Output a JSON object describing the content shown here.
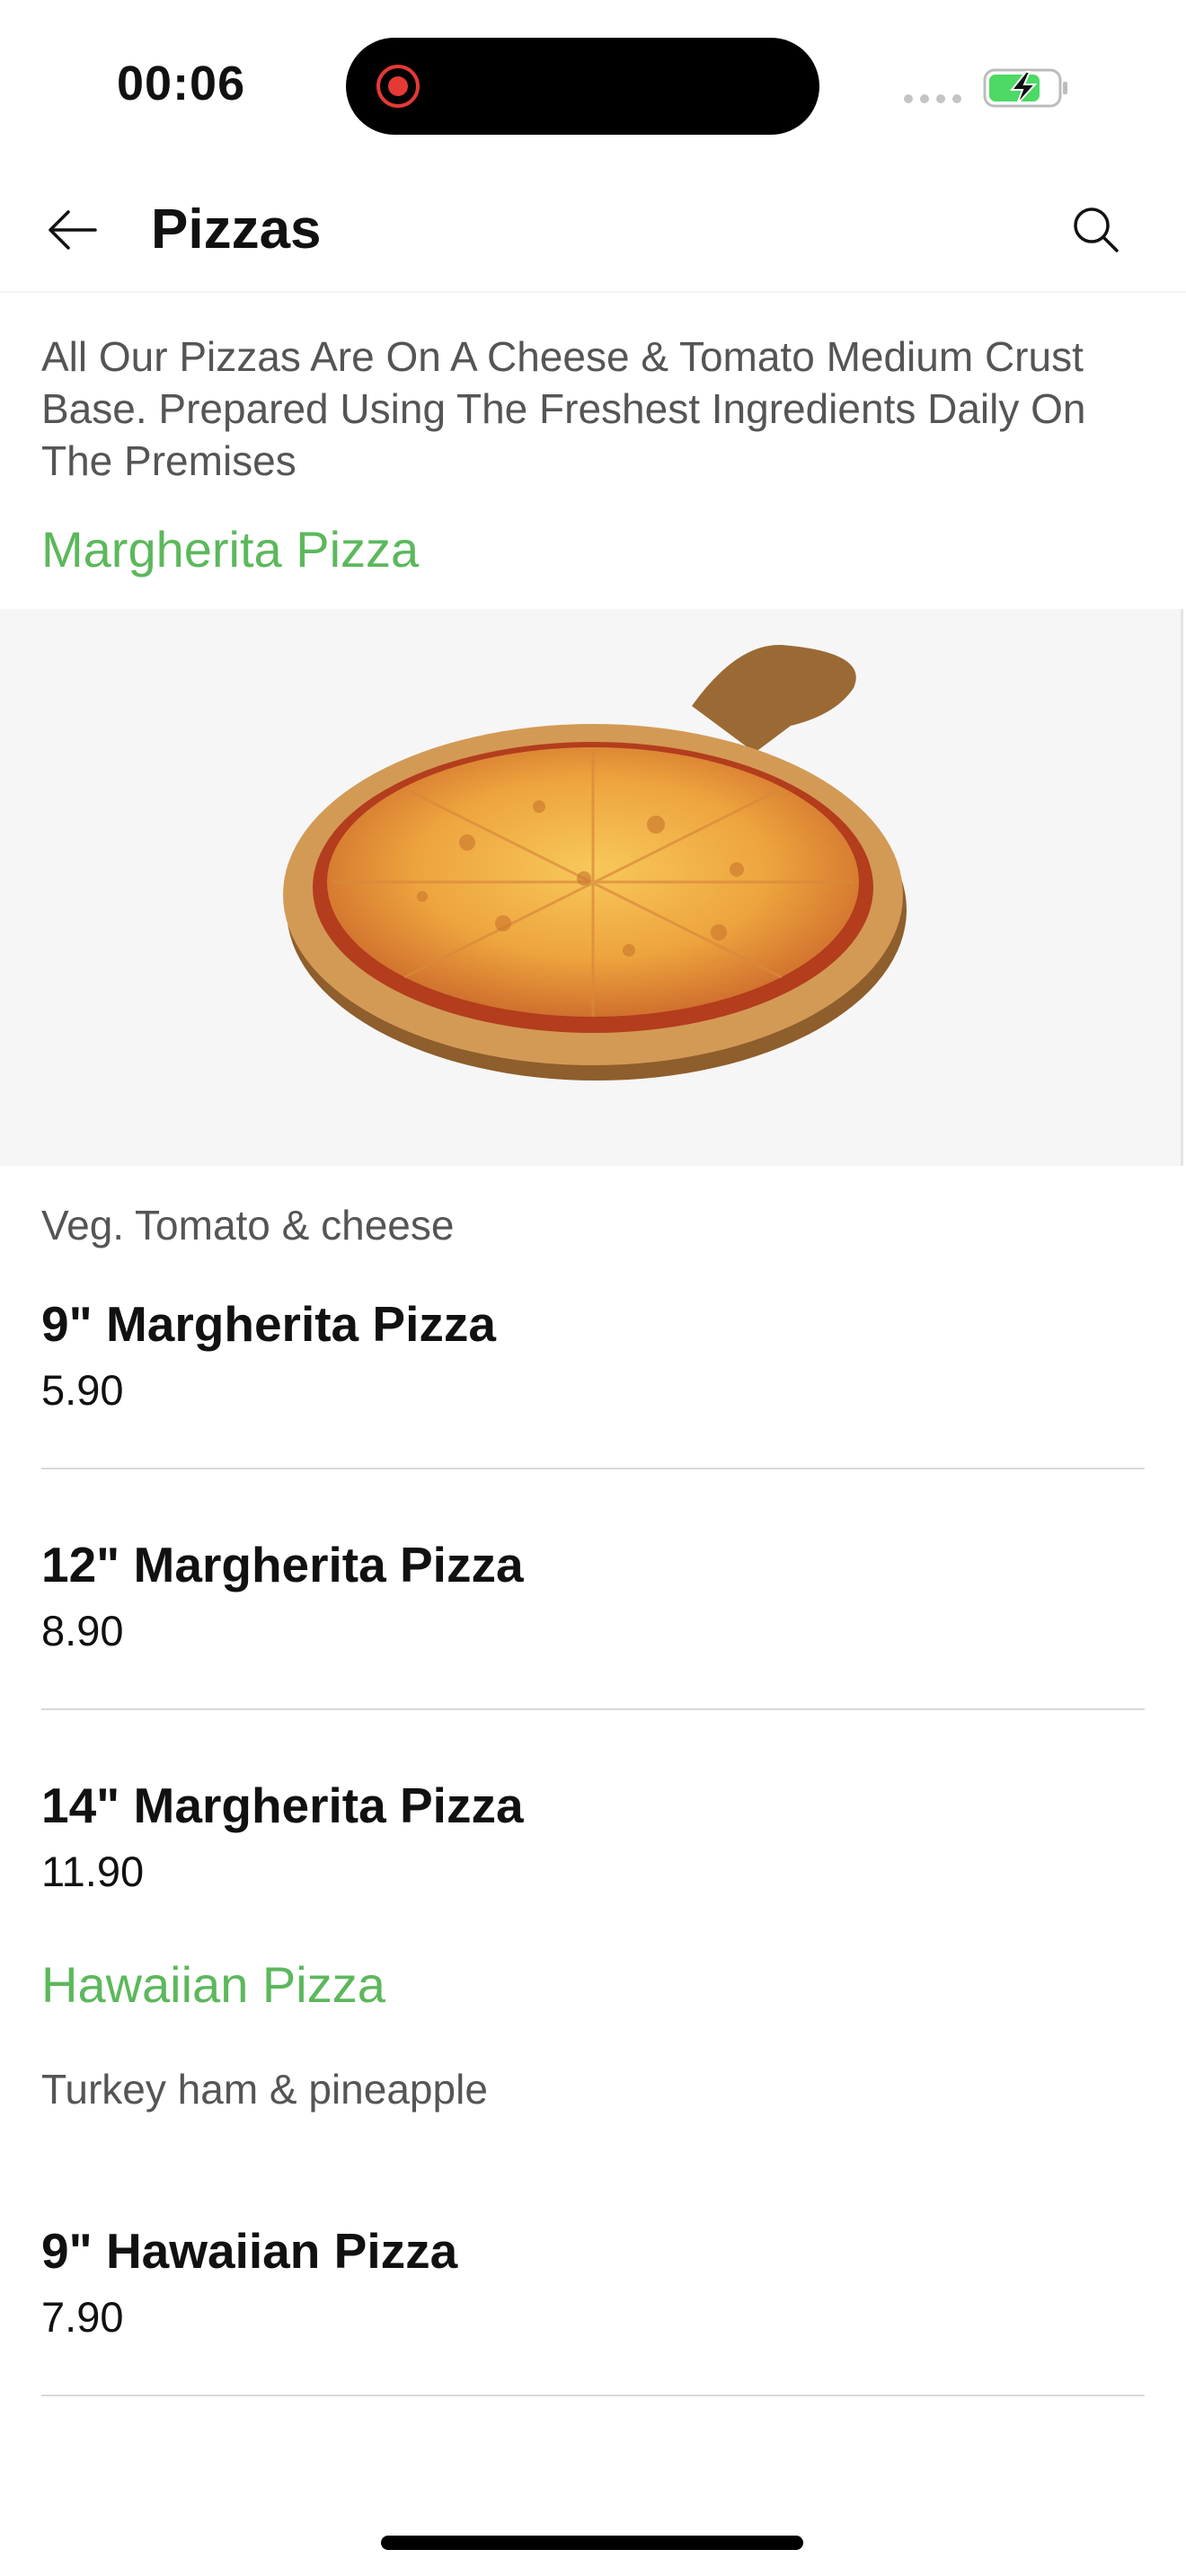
{
  "status_bar": {
    "time": "00:06"
  },
  "header": {
    "title": "Pizzas"
  },
  "intro": "All Our Pizzas Are On A Cheese & Tomato Medium Crust Base. Prepared Using The Freshest Ingredients Daily On The Premises",
  "sections": [
    {
      "title": "Margherita Pizza",
      "description": "Veg. Tomato & cheese",
      "items": [
        {
          "name": "9\" Margherita Pizza",
          "price": "5.90"
        },
        {
          "name": "12\" Margherita Pizza",
          "price": "8.90"
        },
        {
          "name": "14\" Margherita Pizza",
          "price": "11.90"
        }
      ]
    },
    {
      "title": "Hawaiian Pizza",
      "description": "Turkey ham & pineapple",
      "items": [
        {
          "name": "9\" Hawaiian Pizza",
          "price": "7.90"
        }
      ]
    }
  ],
  "colors": {
    "accent": "#5cb85c",
    "battery": "#4cd964",
    "record": "#e53935"
  },
  "icons": [
    "back-arrow-icon",
    "search-icon",
    "record-icon",
    "signal-icon",
    "battery-charging-icon"
  ]
}
